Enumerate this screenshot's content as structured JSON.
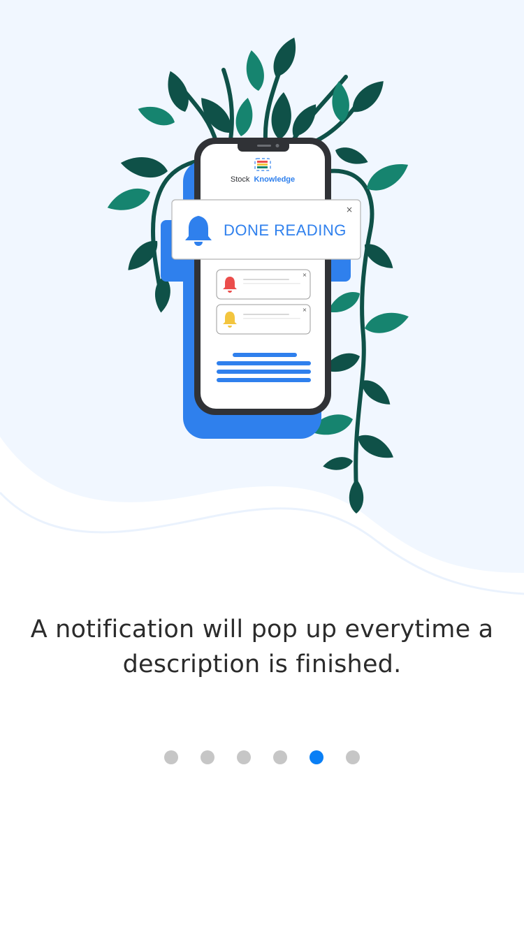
{
  "colors": {
    "background_tint": "#f1f7ff",
    "accent_blue": "#2f80ed",
    "active_dot": "#0a7ff5",
    "inactive_dot": "#c6c6c6",
    "leaf_dark": "#0f5148",
    "leaf_teal": "#16846f",
    "phone_frame": "#303236",
    "bell_red": "#eb4d4b",
    "bell_yellow": "#f3c53e"
  },
  "illustration": {
    "brand_word_1": "Stock",
    "brand_word_2": "Knowledge",
    "notification_title": "DONE READING",
    "close_glyph": "×",
    "icons": [
      "bell-icon",
      "close-icon",
      "logo-icon"
    ]
  },
  "onboarding": {
    "description_line_1": "A notification will pop up everytime a",
    "description_line_2": "description is finished."
  },
  "pager": {
    "total": 6,
    "active_index": 4
  }
}
